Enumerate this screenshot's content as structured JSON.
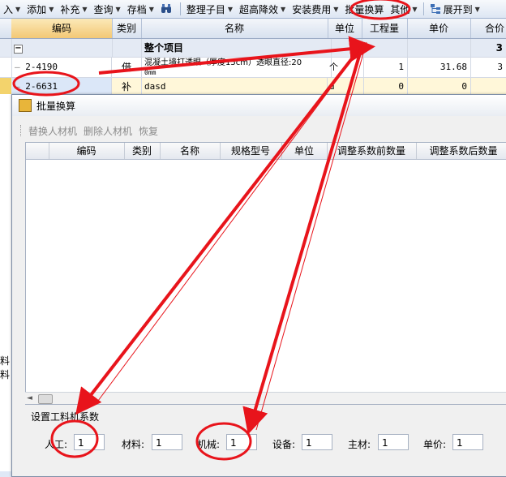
{
  "toolbar": {
    "import_label": "入",
    "add_label": "添加",
    "supplement_label": "补充",
    "query_label": "查询",
    "save_label": "存档",
    "organize_label": "整理子目",
    "height_label": "超高降效",
    "install_label": "安装费用",
    "batch_label": "批量换算",
    "other_label": "其他",
    "expand_label": "展开到"
  },
  "grid": {
    "columns": [
      "编码",
      "类别",
      "名称",
      "单位",
      "工程量",
      "单价",
      "合价"
    ],
    "group_row": {
      "toggle": "−",
      "name": "整个项目",
      "total": "3"
    },
    "rows": [
      {
        "code": "2-4190",
        "type": "借",
        "name": "混凝土墙打透眼（厚度15cm）透眼直径:20",
        "name2": "0mm",
        "unit": "个",
        "qty": "1",
        "price": "31.68",
        "total": "3"
      },
      {
        "code": "2-6631",
        "type": "补",
        "name": "dasd",
        "unit": "d",
        "qty": "0",
        "price": "0",
        "total": ""
      }
    ]
  },
  "side": {
    "label": "料料"
  },
  "dialog": {
    "title": "批量换算",
    "tools": [
      "替换人材机",
      "删除人材机",
      "恢复"
    ],
    "columns": [
      "编码",
      "类别",
      "名称",
      "规格型号",
      "单位",
      "调整系数前数量",
      "调整系数后数量"
    ],
    "coef_title": "设置工料机系数",
    "coefs": [
      {
        "label": "人工:",
        "value": "1"
      },
      {
        "label": "材料:",
        "value": "1"
      },
      {
        "label": "机械:",
        "value": "1"
      },
      {
        "label": "设备:",
        "value": "1"
      },
      {
        "label": "主材:",
        "value": "1"
      },
      {
        "label": "单价:",
        "value": "1"
      }
    ]
  },
  "annotation": {
    "color": "#e8141b"
  }
}
